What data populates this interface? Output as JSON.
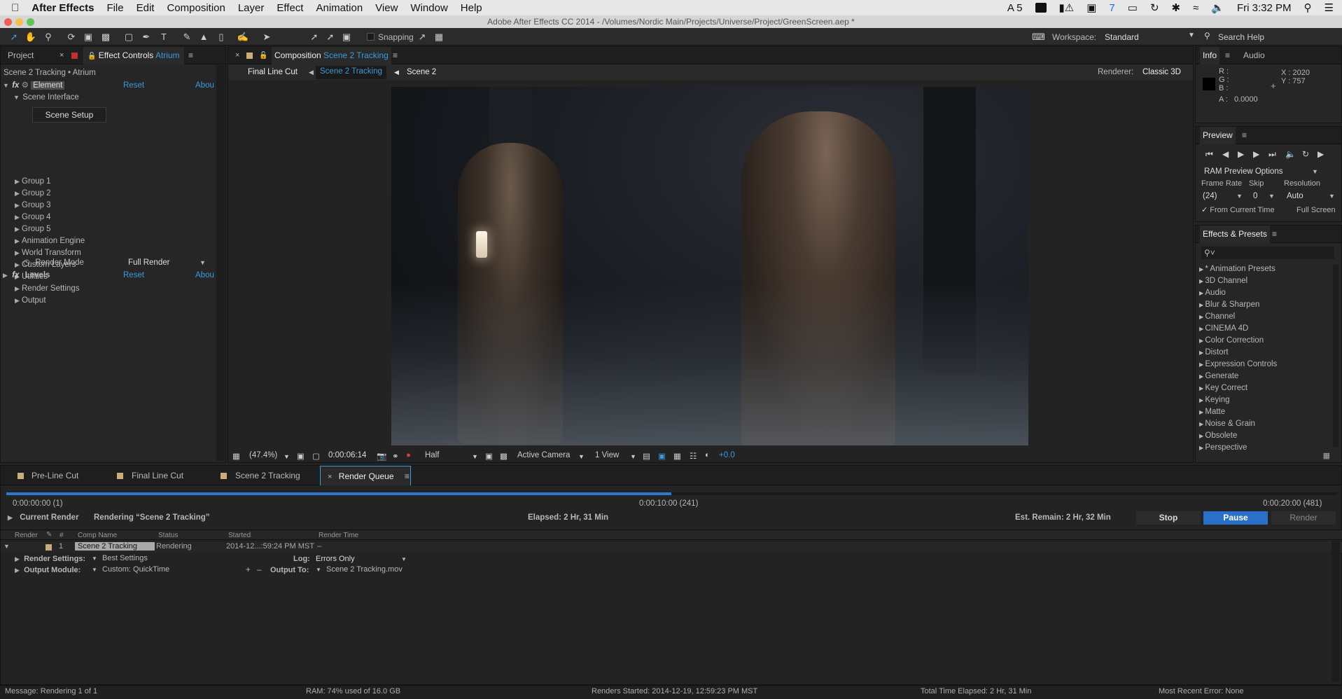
{
  "menubar": {
    "app": "After Effects",
    "items": [
      "File",
      "Edit",
      "Composition",
      "Layer",
      "Effect",
      "Animation",
      "View",
      "Window",
      "Help"
    ],
    "status_icons": [
      "A 5",
      "7"
    ],
    "clock": "Fri 3:32 PM"
  },
  "window_title": "Adobe After Effects CC 2014 - /Volumes/Nordic Main/Projects/Universe/Project/GreenScreen.aep *",
  "toolbar": {
    "snapping_label": "Snapping",
    "workspace_label": "Workspace:",
    "workspace_value": "Standard",
    "search_help": "Search Help"
  },
  "left_panel": {
    "tab_project": "Project",
    "tab_effect_controls": "Effect Controls",
    "tab_effect_controls_layer": "Atrium",
    "breadcrumb": "Scene 2 Tracking • Atrium",
    "effect1_name": "Element",
    "effect1_reset": "Reset",
    "effect1_about": "Abou",
    "scene_interface": "Scene Interface",
    "scene_setup_button": "Scene Setup",
    "groups": [
      "Group 1",
      "Group 2",
      "Group 3",
      "Group 4",
      "Group 5",
      "Animation Engine",
      "World Transform",
      "Custom Layers",
      "Utilities",
      "Render Settings",
      "Output"
    ],
    "render_mode_label": "Render Mode",
    "render_mode_value": "Full Render",
    "effect2_name": "Levels",
    "effect2_reset": "Reset",
    "effect2_about": "Abou"
  },
  "composition": {
    "tab_label": "Composition",
    "tab_comp_name": "Scene 2 Tracking",
    "breadcrumbs": [
      "Final Line Cut",
      "Scene 2 Tracking",
      "Scene 2"
    ],
    "renderer_label": "Renderer:",
    "renderer_value": "Classic 3D",
    "zoom": "(47.4%)",
    "timecode": "0:00:06:14",
    "resolution": "Half",
    "camera": "Active Camera",
    "views": "1 View",
    "exposure": "+0.0"
  },
  "info_panel": {
    "tab_info": "Info",
    "tab_audio": "Audio",
    "r_label": "R :",
    "g_label": "G :",
    "b_label": "B :",
    "a_label": "A :",
    "a_value": "0.0000",
    "x_readout": "X : 2020",
    "y_readout": "Y : 757"
  },
  "preview_panel": {
    "title": "Preview",
    "ram_options": "RAM Preview Options",
    "frame_rate_label": "Frame Rate",
    "frame_rate_value": "(24)",
    "skip_label": "Skip",
    "skip_value": "0",
    "resolution_label": "Resolution",
    "resolution_value": "Auto",
    "from_current_time": "From Current Time",
    "full_screen": "Full Screen"
  },
  "effects_presets": {
    "title": "Effects & Presets",
    "items": [
      "* Animation Presets",
      "3D Channel",
      "Audio",
      "Blur & Sharpen",
      "Channel",
      "CINEMA 4D",
      "Color Correction",
      "Distort",
      "Expression Controls",
      "Generate",
      "Key Correct",
      "Keying",
      "Matte",
      "Noise & Grain",
      "Obsolete",
      "Perspective"
    ]
  },
  "bottom_tabs": [
    "Pre-Line Cut",
    "Final Line Cut",
    "Scene 2 Tracking",
    "Render Queue"
  ],
  "render_queue": {
    "progress_fraction": 0.5,
    "time_start": "0:00:00:00 (1)",
    "time_mid": "0:00:10:00 (241)",
    "time_end": "0:00:20:00 (481)",
    "current_render_label": "Current Render",
    "rendering_text": "Rendering “Scene 2 Tracking”",
    "elapsed": "Elapsed: 2 Hr, 31 Min",
    "est_remain": "Est. Remain: 2 Hr, 32 Min",
    "stop_button": "Stop",
    "pause_button": "Pause",
    "render_button": "Render",
    "columns": [
      "Render",
      "#",
      "Comp Name",
      "Status",
      "Started",
      "Render Time"
    ],
    "item": {
      "index": "1",
      "comp_name": "Scene 2 Tracking",
      "status": "Rendering",
      "started": "2014-12...:59:24 PM MST",
      "render_time": "–"
    },
    "render_settings_label": "Render Settings:",
    "render_settings_value": "Best Settings",
    "log_label": "Log:",
    "log_value": "Errors Only",
    "output_module_label": "Output Module:",
    "output_module_value": "Custom: QuickTime",
    "output_to_label": "Output To:",
    "output_to_value": "Scene 2 Tracking.mov"
  },
  "statusbar": {
    "message": "Message: Rendering 1 of 1",
    "ram": "RAM: 74% used of 16.0 GB",
    "renders_started": "Renders Started: 2014-12-19, 12:59:23 PM MST",
    "total_elapsed": "Total Time Elapsed: 2 Hr, 31 Min",
    "recent_error": "Most Recent Error: None"
  },
  "colors": {
    "accent_blue": "#3b9bdc",
    "pause_button_bg": "#2a70c8",
    "progress_bar": "#2f78d0"
  }
}
